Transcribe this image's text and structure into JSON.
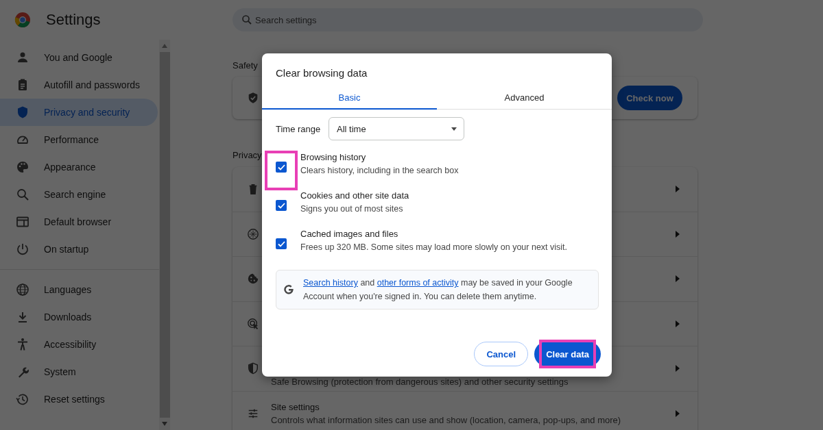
{
  "header": {
    "title": "Settings",
    "search": {
      "placeholder": "Search settings"
    }
  },
  "sidebar": {
    "groups": [
      [
        {
          "label": "You and Google",
          "selected": false
        },
        {
          "label": "Autofill and passwords",
          "selected": false
        },
        {
          "label": "Privacy and security",
          "selected": true
        },
        {
          "label": "Performance",
          "selected": false
        },
        {
          "label": "Appearance",
          "selected": false
        },
        {
          "label": "Search engine",
          "selected": false
        },
        {
          "label": "Default browser",
          "selected": false
        },
        {
          "label": "On startup",
          "selected": false
        }
      ],
      [
        {
          "label": "Languages",
          "selected": false
        },
        {
          "label": "Downloads",
          "selected": false
        },
        {
          "label": "Accessibility",
          "selected": false
        },
        {
          "label": "System",
          "selected": false
        },
        {
          "label": "Reset settings",
          "selected": false
        }
      ]
    ]
  },
  "main": {
    "safety": {
      "heading": "Safety",
      "button": "Check now"
    },
    "privacy": {
      "heading": "Privacy",
      "rows": [
        {},
        {},
        {},
        {},
        {
          "subtitle": "Safe Browsing (protection from dangerous sites) and other security settings"
        },
        {
          "title": "Site settings",
          "subtitle": "Controls what information sites can use and show (location, camera, pop-ups, and more)"
        }
      ]
    }
  },
  "dialog": {
    "title": "Clear browsing data",
    "tabs": [
      {
        "label": "Basic",
        "selected": true
      },
      {
        "label": "Advanced",
        "selected": false
      }
    ],
    "time_range": {
      "label": "Time range",
      "value": "All time"
    },
    "options": [
      {
        "label": "Browsing history",
        "description": "Clears history, including in the search box",
        "checked": true,
        "highlighted": true
      },
      {
        "label": "Cookies and other site data",
        "description": "Signs you out of most sites",
        "checked": true,
        "highlighted": false
      },
      {
        "label": "Cached images and files",
        "description": "Frees up 320 MB. Some sites may load more slowly on your next visit.",
        "checked": true,
        "highlighted": false
      }
    ],
    "notice": [
      {
        "kind": "link",
        "text": "Search history"
      },
      {
        "kind": "text",
        "text": " and "
      },
      {
        "kind": "link",
        "text": "other forms of activity"
      },
      {
        "kind": "text",
        "text": " may be saved in your Google Account when you're signed in. You can delete them anytime."
      }
    ],
    "buttons": [
      {
        "label": "Cancel",
        "kind": "secondary",
        "highlighted": false
      },
      {
        "label": "Clear data",
        "kind": "primary",
        "highlighted": true
      }
    ]
  }
}
